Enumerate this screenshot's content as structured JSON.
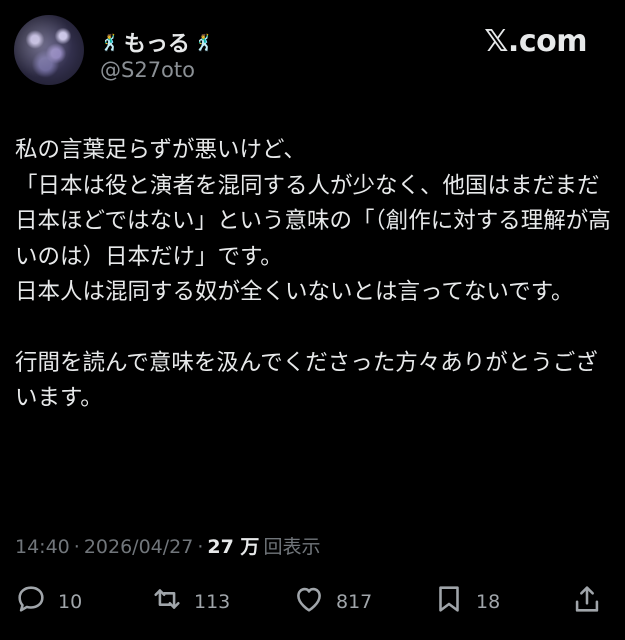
{
  "author": {
    "display_name": "もっる",
    "name_emoji": "🕺",
    "handle": "@S27oto"
  },
  "brand": {
    "logo_text": "𝕏.com"
  },
  "post": {
    "paragraphs": [
      "私の言葉足らずが悪いけど、",
      "「日本は役と演者を混同する人が少なく、他国はまだまだ日本ほどではない」という意味の「（創作に対する理解が高いのは）日本だけ」です。",
      "日本人は混同する奴が全くいないとは言ってないです。",
      "",
      "行間を読んで意味を汲んでくださった方々ありがとうございます。"
    ]
  },
  "meta": {
    "time": "14:40",
    "separator": "·",
    "date": "2026/04/27",
    "views_count": "27 万",
    "views_label": "回表示"
  },
  "actions": {
    "reply_count": "10",
    "repost_count": "113",
    "like_count": "817",
    "bookmark_count": "18"
  },
  "colors": {
    "background": "#000000",
    "text_primary": "#e7e9ea",
    "text_secondary": "#71767b"
  }
}
